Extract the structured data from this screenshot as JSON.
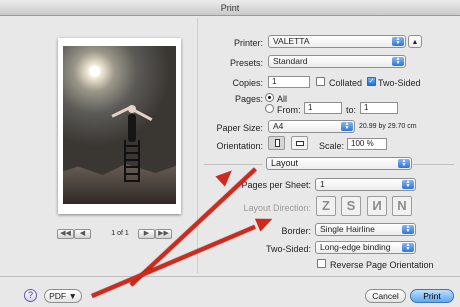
{
  "window": {
    "title": "Print"
  },
  "preview": {
    "page_indicator": "1 of 1",
    "nav_buttons": [
      "◀◀",
      "◀",
      "▶",
      "▶▶"
    ]
  },
  "form": {
    "printer": {
      "label": "Printer:",
      "value": "VALETTA"
    },
    "presets": {
      "label": "Presets:",
      "value": "Standard"
    },
    "copies": {
      "label": "Copies:",
      "value": "1"
    },
    "collated": {
      "label": "Collated",
      "checked": false
    },
    "two_sided": {
      "label": "Two-Sided",
      "checked": true
    },
    "pages": {
      "label": "Pages:",
      "all_label": "All",
      "from_label": "From:",
      "from_value": "1",
      "to_label": "to:",
      "to_value": "1"
    },
    "paper_size": {
      "label": "Paper Size:",
      "value": "A4",
      "dimensions": "20.99 by 29.70 cm"
    },
    "orientation": {
      "label": "Orientation:",
      "selected": "portrait"
    },
    "scale": {
      "label": "Scale:",
      "value": "100 %"
    },
    "section": {
      "value": "Layout"
    },
    "pages_per_sheet": {
      "label": "Pages per Sheet:",
      "value": "1"
    },
    "layout_direction": {
      "label": "Layout Direction:",
      "icons": [
        "Z",
        "S",
        "И",
        "N"
      ]
    },
    "border": {
      "label": "Border:",
      "value": "Single Hairline"
    },
    "two_sided_binding": {
      "label": "Two-Sided:",
      "value": "Long-edge binding"
    },
    "reverse": {
      "label": "Reverse Page Orientation",
      "checked": false
    }
  },
  "footer": {
    "help_label": "?",
    "pdf_label": "PDF ▼",
    "cancel_label": "Cancel",
    "print_label": "Print"
  },
  "colors": {
    "accent": "#3b82e6",
    "annotation": "#cf2a1c"
  }
}
